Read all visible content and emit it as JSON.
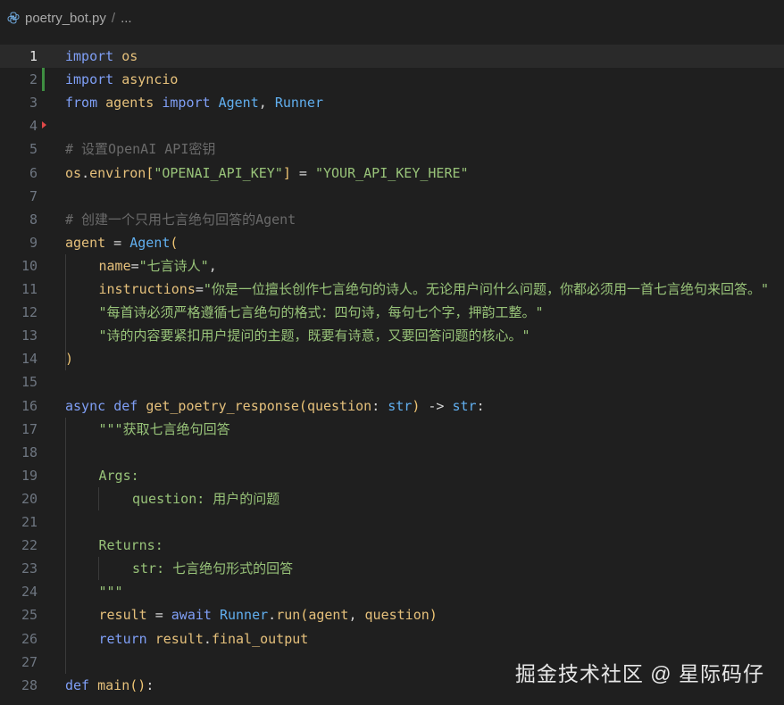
{
  "breadcrumb": {
    "file_name": "poetry_bot.py",
    "separator": "/",
    "ellipsis": "..."
  },
  "watermark": "掘金技术社区 @ 星际码仔",
  "colors": {
    "keyword": "#c586c0",
    "import_kw": "#7f9ff6",
    "identifier": "#e6c07b",
    "string": "#98c379",
    "comment": "#6a6a6a",
    "function": "#61afef",
    "param": "#e5c07b",
    "plain": "#d4d4d4",
    "bracket": "#f0c674"
  },
  "editor": {
    "current_line": 1,
    "lines": [
      {
        "num": "1",
        "indent": 0,
        "tokens": [
          [
            "import",
            "kw"
          ],
          [
            " ",
            "p"
          ],
          [
            "os",
            "id"
          ]
        ]
      },
      {
        "num": "2",
        "indent": 0,
        "mark": "modified",
        "tokens": [
          [
            "import",
            "kw"
          ],
          [
            " ",
            "p"
          ],
          [
            "asyncio",
            "id"
          ]
        ]
      },
      {
        "num": "3",
        "indent": 0,
        "tokens": [
          [
            "from",
            "kw"
          ],
          [
            " ",
            "p"
          ],
          [
            "agents",
            "id"
          ],
          [
            " ",
            "p"
          ],
          [
            "import",
            "kw"
          ],
          [
            " ",
            "p"
          ],
          [
            "Agent",
            "cls"
          ],
          [
            ",",
            "p"
          ],
          [
            " ",
            "p"
          ],
          [
            "Runner",
            "cls"
          ]
        ]
      },
      {
        "num": "4",
        "indent": 0,
        "mark": "deleted",
        "tokens": []
      },
      {
        "num": "5",
        "indent": 0,
        "tokens": [
          [
            "# 设置OpenAI API密钥",
            "cm"
          ]
        ]
      },
      {
        "num": "6",
        "indent": 0,
        "tokens": [
          [
            "os",
            "id"
          ],
          [
            ".",
            "p"
          ],
          [
            "environ",
            "id"
          ],
          [
            "[",
            "br"
          ],
          [
            "\"OPENAI_API_KEY\"",
            "str"
          ],
          [
            "]",
            "br"
          ],
          [
            " = ",
            "p"
          ],
          [
            "\"YOUR_API_KEY_HERE\"",
            "str"
          ]
        ]
      },
      {
        "num": "7",
        "indent": 0,
        "tokens": []
      },
      {
        "num": "8",
        "indent": 0,
        "tokens": [
          [
            "# 创建一个只用七言绝句回答的Agent",
            "cm"
          ]
        ]
      },
      {
        "num": "9",
        "indent": 0,
        "tokens": [
          [
            "agent",
            "id"
          ],
          [
            " = ",
            "p"
          ],
          [
            "Agent",
            "cls"
          ],
          [
            "(",
            "br"
          ]
        ]
      },
      {
        "num": "10",
        "indent": 1,
        "tokens": [
          [
            "name",
            "param"
          ],
          [
            "=",
            "p"
          ],
          [
            "\"七言诗人\"",
            "str"
          ],
          [
            ",",
            "p"
          ]
        ]
      },
      {
        "num": "11",
        "indent": 1,
        "tokens": [
          [
            "instructions",
            "param"
          ],
          [
            "=",
            "p"
          ],
          [
            "\"你是一位擅长创作七言绝句的诗人。无论用户问什么问题，你都必须用一首七言绝句来回答。\"",
            "str"
          ]
        ]
      },
      {
        "num": "12",
        "indent": 1,
        "tokens": [
          [
            "\"每首诗必须严格遵循七言绝句的格式：四句诗，每句七个字，押韵工整。\"",
            "str"
          ]
        ]
      },
      {
        "num": "13",
        "indent": 1,
        "tokens": [
          [
            "\"诗的内容要紧扣用户提问的主题，既要有诗意，又要回答问题的核心。\"",
            "str"
          ]
        ]
      },
      {
        "num": "14",
        "indent": 0,
        "tokens": [
          [
            ")",
            "br"
          ]
        ]
      },
      {
        "num": "15",
        "indent": 0,
        "tokens": []
      },
      {
        "num": "16",
        "indent": 0,
        "tokens": [
          [
            "async",
            "kw"
          ],
          [
            " ",
            "p"
          ],
          [
            "def",
            "kw"
          ],
          [
            " ",
            "p"
          ],
          [
            "get_poetry_response",
            "fn"
          ],
          [
            "(",
            "br"
          ],
          [
            "question",
            "param"
          ],
          [
            ": ",
            "p"
          ],
          [
            "str",
            "cls"
          ],
          [
            ")",
            "br"
          ],
          [
            " -> ",
            "p"
          ],
          [
            "str",
            "cls"
          ],
          [
            ":",
            "p"
          ]
        ]
      },
      {
        "num": "17",
        "indent": 1,
        "tokens": [
          [
            "\"\"\"获取七言绝句回答",
            "str"
          ]
        ]
      },
      {
        "num": "18",
        "indent": 0,
        "tokens": []
      },
      {
        "num": "19",
        "indent": 1,
        "tokens": [
          [
            "Args:",
            "str"
          ]
        ]
      },
      {
        "num": "20",
        "indent": 2,
        "tokens": [
          [
            "question: 用户的问题",
            "str"
          ]
        ]
      },
      {
        "num": "21",
        "indent": 0,
        "tokens": []
      },
      {
        "num": "22",
        "indent": 1,
        "tokens": [
          [
            "Returns:",
            "str"
          ]
        ]
      },
      {
        "num": "23",
        "indent": 2,
        "tokens": [
          [
            "str: 七言绝句形式的回答",
            "str"
          ]
        ]
      },
      {
        "num": "24",
        "indent": 1,
        "tokens": [
          [
            "\"\"\"",
            "str"
          ]
        ]
      },
      {
        "num": "25",
        "indent": 1,
        "tokens": [
          [
            "result",
            "id"
          ],
          [
            " = ",
            "p"
          ],
          [
            "await",
            "kw"
          ],
          [
            " ",
            "p"
          ],
          [
            "Runner",
            "cls"
          ],
          [
            ".",
            "p"
          ],
          [
            "run",
            "fn"
          ],
          [
            "(",
            "br"
          ],
          [
            "agent",
            "id"
          ],
          [
            ", ",
            "p"
          ],
          [
            "question",
            "id"
          ],
          [
            ")",
            "br"
          ]
        ]
      },
      {
        "num": "26",
        "indent": 1,
        "tokens": [
          [
            "return",
            "kw"
          ],
          [
            " ",
            "p"
          ],
          [
            "result",
            "id"
          ],
          [
            ".",
            "p"
          ],
          [
            "final_output",
            "id"
          ]
        ]
      },
      {
        "num": "27",
        "indent": 0,
        "tokens": []
      },
      {
        "num": "28",
        "indent": 0,
        "tokens": [
          [
            "def",
            "kw"
          ],
          [
            " ",
            "p"
          ],
          [
            "main",
            "fn"
          ],
          [
            "()",
            "br"
          ],
          [
            ":",
            "p"
          ]
        ]
      }
    ]
  }
}
